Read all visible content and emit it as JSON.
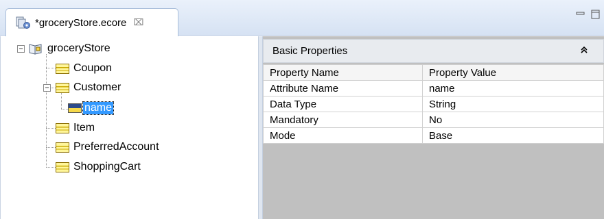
{
  "tab": {
    "title": "*groceryStore.ecore",
    "close_glyph": "⌧"
  },
  "window_controls": {
    "minimize_glyph": "▭",
    "maximize_glyph": "▢"
  },
  "tree": {
    "root": {
      "label": "groceryStore",
      "icon": "package-icon",
      "expander": "−"
    },
    "items": [
      {
        "label": "Coupon",
        "icon": "class-icon"
      },
      {
        "label": "Customer",
        "icon": "class-icon",
        "expander": "−",
        "children": [
          {
            "label": "name",
            "icon": "attribute-icon",
            "selected": true
          }
        ]
      },
      {
        "label": "Item",
        "icon": "class-icon"
      },
      {
        "label": "PreferredAccount",
        "icon": "class-icon"
      },
      {
        "label": "ShoppingCart",
        "icon": "class-icon"
      }
    ]
  },
  "properties": {
    "section_title": "Basic Properties",
    "collapse_glyph": "⌃",
    "columns": [
      "Property Name",
      "Property Value"
    ],
    "rows": [
      {
        "name": "Attribute Name",
        "value": "name"
      },
      {
        "name": "Data Type",
        "value": "String"
      },
      {
        "name": "Mandatory",
        "value": "No"
      },
      {
        "name": "Mode",
        "value": "Base"
      }
    ]
  },
  "colors": {
    "selection": "#3399ff",
    "tab_bar": "#d6e2f3",
    "empty_area": "#c0c0c0"
  }
}
